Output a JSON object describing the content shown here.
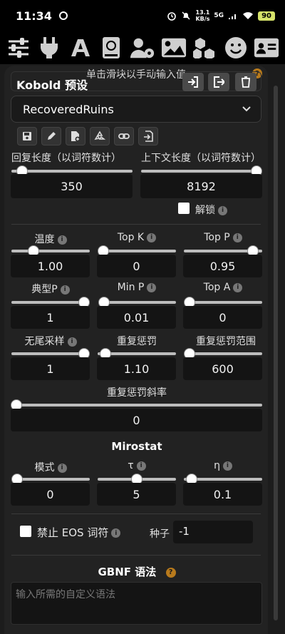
{
  "status_bar": {
    "time": "11:34",
    "speed_value": "13.1",
    "speed_unit": "KB/s",
    "network": "5G",
    "battery": "90"
  },
  "top_icons": [
    "sliders-icon",
    "plug-icon",
    "font-icon",
    "book-icon",
    "user-gear-icon",
    "image-icon",
    "cubes-icon",
    "smiley-icon",
    "id-card-icon"
  ],
  "hint": "单击滑块以手动输入值",
  "preset": {
    "title": "Kobold 预设",
    "selected": "RecoveredRuins"
  },
  "response_length": {
    "label": "回复长度（以词符数计）",
    "value": "350",
    "fraction": 0.09
  },
  "context_length": {
    "label": "上下文长度（以词符数计）",
    "value": "8192",
    "fraction": 1.0
  },
  "unlock": {
    "label": "解锁",
    "checked": false
  },
  "params": {
    "temperature": {
      "label": "温度",
      "value": "1.00",
      "fraction": 0.28
    },
    "top_k": {
      "label": "Top K",
      "value": "0",
      "fraction": 0.0
    },
    "top_p": {
      "label": "Top P",
      "value": "0.95",
      "fraction": 0.88
    },
    "typical_p": {
      "label": "典型P",
      "value": "1",
      "fraction": 1.0
    },
    "min_p": {
      "label": "Min P",
      "value": "0.01",
      "fraction": 0.01
    },
    "top_a": {
      "label": "Top A",
      "value": "0",
      "fraction": 0.0
    },
    "tail_free": {
      "label": "无尾采样",
      "value": "1",
      "fraction": 1.0
    },
    "rep_pen": {
      "label": "重复惩罚",
      "value": "1.10",
      "fraction": 0.1
    },
    "rep_pen_range": {
      "label": "重复惩罚范围",
      "value": "600",
      "fraction": 0.07
    },
    "rep_pen_slope": {
      "label": "重复惩罚斜率",
      "value": "0",
      "fraction": 0.0
    }
  },
  "mirostat": {
    "heading": "Mirostat",
    "mode": {
      "label": "模式",
      "value": "0",
      "fraction": 0.0
    },
    "tau": {
      "label": "τ",
      "value": "5",
      "fraction": 0.5
    },
    "eta": {
      "label": "η",
      "value": "0.1",
      "fraction": 0.1
    }
  },
  "ban_eos": {
    "label": "禁止 EOS 词符",
    "checked": false
  },
  "seed": {
    "label": "种子",
    "value": "-1"
  },
  "gbnf": {
    "heading": "GBNF 语法",
    "placeholder": "输入所需的自定义语法"
  },
  "colors": {
    "accent_help": "#b87a1c",
    "background": "#222222"
  }
}
